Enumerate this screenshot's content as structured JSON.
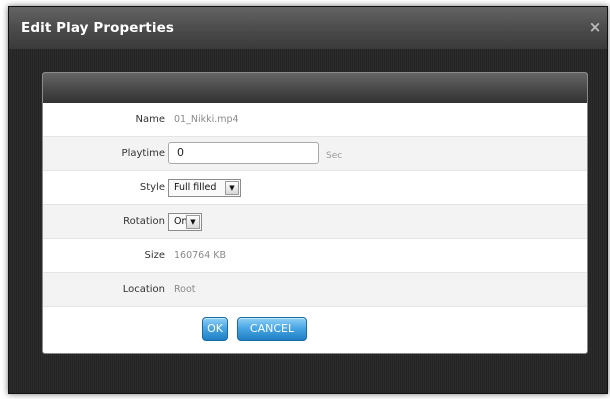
{
  "dialog": {
    "title": "Edit Play Properties",
    "close_glyph": "×"
  },
  "fields": {
    "name": {
      "label": "Name",
      "value": "01_Nikki.mp4"
    },
    "playtime": {
      "label": "Playtime",
      "value": "0",
      "unit": "Sec"
    },
    "style": {
      "label": "Style",
      "selected": "Full filled"
    },
    "rotation": {
      "label": "Rotation",
      "selected": "On"
    },
    "size": {
      "label": "Size",
      "value": "160764 KB"
    },
    "location": {
      "label": "Location",
      "value": "Root"
    }
  },
  "buttons": {
    "ok": "OK",
    "cancel": "CANCEL"
  },
  "icons": {
    "close": "close-icon",
    "dropdown": "chevron-down-icon"
  },
  "colors": {
    "button_accent": "#4aa7e4",
    "titlebar": "#4e4e4e"
  }
}
